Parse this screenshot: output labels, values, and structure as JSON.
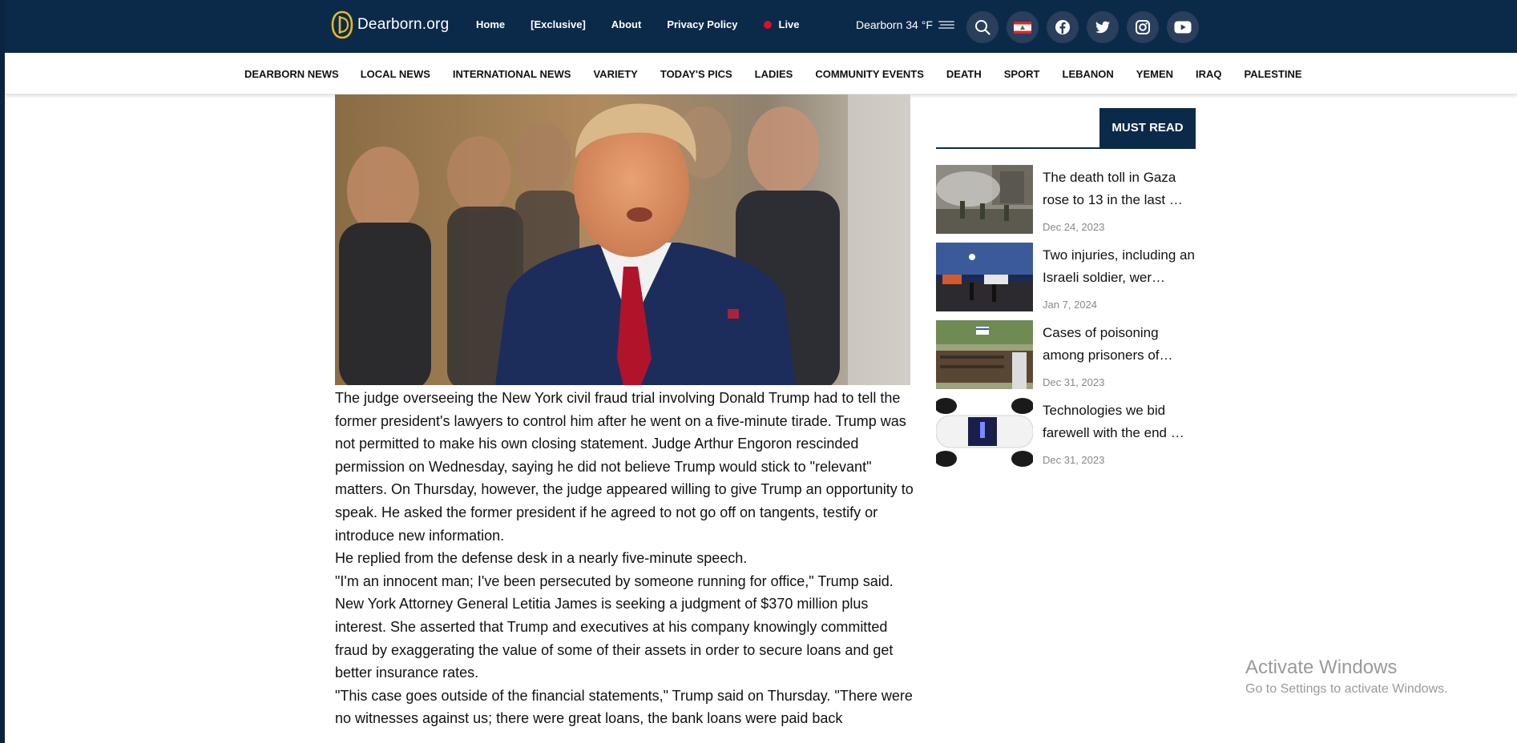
{
  "header": {
    "logo_text": "Dearborn.org",
    "nav": [
      {
        "label": "Home"
      },
      {
        "label": "[Exclusive]"
      },
      {
        "label": "About"
      },
      {
        "label": "Privacy Policy"
      },
      {
        "label": "Live"
      }
    ],
    "weather": "Dearborn 34 °F",
    "icons": [
      "search-icon",
      "lebanon-flag-icon",
      "facebook-icon",
      "twitter-icon",
      "instagram-icon",
      "youtube-icon"
    ],
    "colors": {
      "bar": "#0b2a4a",
      "live_dot": "#d9102a",
      "icon_circle": "#2a3f5c"
    }
  },
  "categories": [
    "DEARBORN NEWS",
    "LOCAL NEWS",
    "INTERNATIONAL NEWS",
    "VARIETY",
    "TODAY'S PICS",
    "LADIES",
    "COMMUNITY EVENTS",
    "DEATH",
    "SPORT",
    "LEBANON",
    "YEMEN",
    "IRAQ",
    "PALESTINE"
  ],
  "article": {
    "paragraphs": [
      "The judge overseeing the New York civil fraud trial involving Donald Trump had to tell the former president's lawyers to control him after he went on a five-minute tirade. Trump was not permitted to make his own closing statement. Judge Arthur Engoron rescinded permission on Wednesday, saying he did not believe Trump would stick to \"relevant\" matters. On Thursday, however, the judge appeared willing to give Trump an opportunity to speak. He asked the former president if he agreed to not go off on tangents, testify or introduce new information.",
      "He replied from the defense desk in a nearly five-minute speech.",
      "\"I'm an innocent man; I've been persecuted by someone running for office,\" Trump said.",
      "New York Attorney General Letitia James is seeking a judgment of $370 million plus interest. She asserted that Trump and executives at his company knowingly committed fraud by exaggerating the value of some of their assets in order to secure loans and get better insurance rates.",
      "\"This case goes outside of the financial statements,\" Trump said on Thursday. \"There were no witnesses against us; there were great loans, the bank loans were paid back"
    ]
  },
  "sidebar": {
    "heading": "MUST READ",
    "stories": [
      {
        "title": "The death toll in Gaza rose to 13 in the last …",
        "date": "Dec 24, 2023"
      },
      {
        "title": "Two injuries, including an Israeli soldier, wer…",
        "date": "Jan 7, 2024"
      },
      {
        "title": "Cases of poisoning among prisoners of…",
        "date": "Dec 31, 2023"
      },
      {
        "title": "Technologies we bid farewell with the end …",
        "date": "Dec 31, 2023"
      }
    ]
  },
  "watermark": {
    "line1": "Activate Windows",
    "line2": "Go to Settings to activate Windows."
  }
}
